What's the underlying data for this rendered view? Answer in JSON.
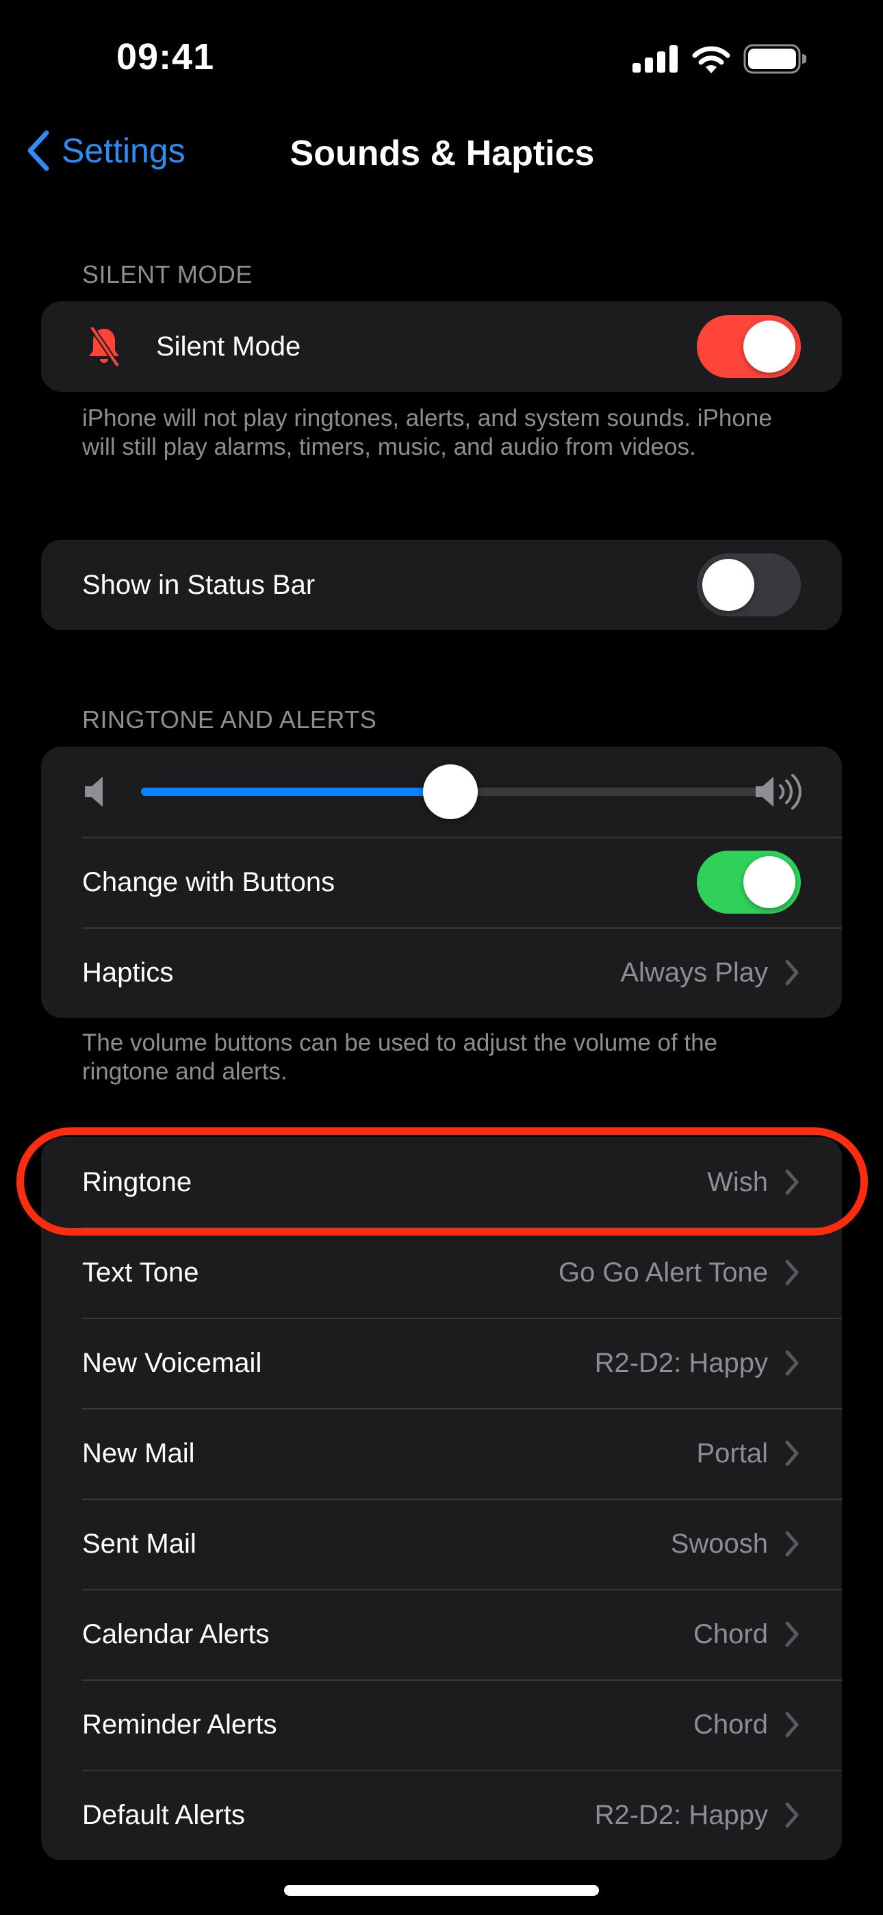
{
  "status_bar": {
    "time": "09:41",
    "icons": [
      "cellular-signal-icon",
      "wifi-icon",
      "battery-icon"
    ]
  },
  "nav": {
    "back_label": "Settings",
    "back_icon": "chevron-left-icon",
    "title": "Sounds & Haptics"
  },
  "colors": {
    "accent": "#2f8cf5",
    "toggle_silent_on": "#ff453a",
    "toggle_on": "#30d158",
    "toggle_off": "#39393d",
    "slider_fill": "#0a84ff",
    "annotation": "#ff2d10"
  },
  "silent_section": {
    "header": "SILENT MODE",
    "silent_mode": {
      "label": "Silent Mode",
      "icon": "bell-slash-icon",
      "on": true
    },
    "footer": "iPhone will not play ringtones, alerts, and system sounds. iPhone will still play alarms, timers, music, and audio from videos."
  },
  "status_bar_section": {
    "show_in_status_bar": {
      "label": "Show in Status Bar",
      "on": false
    }
  },
  "ringtone_alerts": {
    "header": "RINGTONE AND ALERTS",
    "volume": {
      "value": 0.5,
      "min_icon": "speaker-icon",
      "max_icon": "speaker-wave-icon"
    },
    "change_with_buttons": {
      "label": "Change with Buttons",
      "on": true
    },
    "haptics": {
      "label": "Haptics",
      "value": "Always Play"
    },
    "footer": "The volume buttons can be used to adjust the volume of the ringtone and alerts."
  },
  "sounds": [
    {
      "label": "Ringtone",
      "value": "Wish",
      "highlighted": true
    },
    {
      "label": "Text Tone",
      "value": "Go Go Alert Tone"
    },
    {
      "label": "New Voicemail",
      "value": "R2-D2: Happy"
    },
    {
      "label": "New Mail",
      "value": "Portal"
    },
    {
      "label": "Sent Mail",
      "value": "Swoosh"
    },
    {
      "label": "Calendar Alerts",
      "value": "Chord"
    },
    {
      "label": "Reminder Alerts",
      "value": "Chord"
    },
    {
      "label": "Default Alerts",
      "value": "R2-D2: Happy"
    }
  ]
}
